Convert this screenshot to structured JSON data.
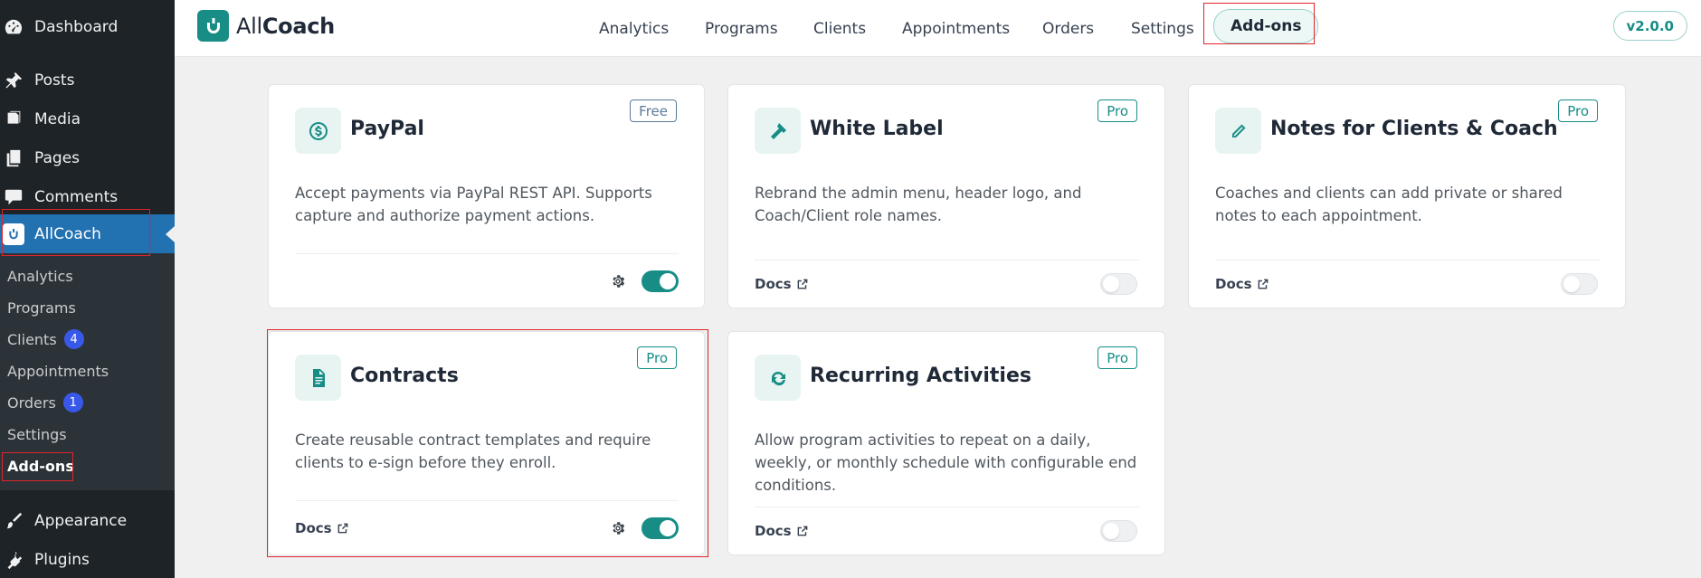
{
  "wp_menu": {
    "items": [
      {
        "label": "Dashboard",
        "icon": "dashboard-icon"
      },
      {
        "label": "Posts",
        "icon": "pushpin-icon"
      },
      {
        "label": "Media",
        "icon": "media-icon"
      },
      {
        "label": "Pages",
        "icon": "pages-icon"
      },
      {
        "label": "Comments",
        "icon": "comments-icon"
      },
      {
        "label": "AllCoach",
        "icon": "allcoach-icon"
      },
      {
        "label": "Appearance",
        "icon": "appearance-icon"
      },
      {
        "label": "Plugins",
        "icon": "plugins-icon"
      }
    ],
    "submenu": [
      {
        "label": "Analytics",
        "badge": ""
      },
      {
        "label": "Programs",
        "badge": ""
      },
      {
        "label": "Clients",
        "badge": "4"
      },
      {
        "label": "Appointments",
        "badge": ""
      },
      {
        "label": "Orders",
        "badge": "1"
      },
      {
        "label": "Settings",
        "badge": ""
      },
      {
        "label": "Add-ons",
        "badge": ""
      }
    ]
  },
  "header": {
    "brand_light": "All",
    "brand_bold": "Coach",
    "nav": [
      "Analytics",
      "Programs",
      "Clients",
      "Appointments",
      "Orders",
      "Settings",
      "Add-ons"
    ],
    "active_nav": "Add-ons",
    "version": "v2.0.0"
  },
  "addons": [
    {
      "title": "PayPal",
      "tag": "Free",
      "icon": "dollar-circle-icon",
      "desc": "Accept payments via PayPal REST API. Supports capture and authorize payment actions.",
      "docs": "",
      "enabled": true
    },
    {
      "title": "White Label",
      "tag": "Pro",
      "icon": "hammer-icon",
      "desc": "Rebrand the admin menu, header logo, and Coach/Client role names.",
      "docs": "Docs",
      "enabled": false
    },
    {
      "title": "Notes for Clients & Coach",
      "tag": "Pro",
      "icon": "pencil-icon",
      "desc": "Coaches and clients can add private or shared notes to each appointment.",
      "docs": "Docs",
      "enabled": false
    },
    {
      "title": "Contracts",
      "tag": "Pro",
      "icon": "document-icon",
      "desc": "Create reusable contract templates and require clients to e-sign before they enroll.",
      "docs": "Docs",
      "enabled": true
    },
    {
      "title": "Recurring Activities",
      "tag": "Pro",
      "icon": "refresh-icon",
      "desc": "Allow program activities to repeat on a daily, weekly, or monthly schedule with configurable end conditions.",
      "docs": "Docs",
      "enabled": false
    }
  ],
  "colors": {
    "accent": "#178d86",
    "wp_sidebar": "#1d2327",
    "wp_active": "#2271b1",
    "highlight": "#e0242c"
  }
}
